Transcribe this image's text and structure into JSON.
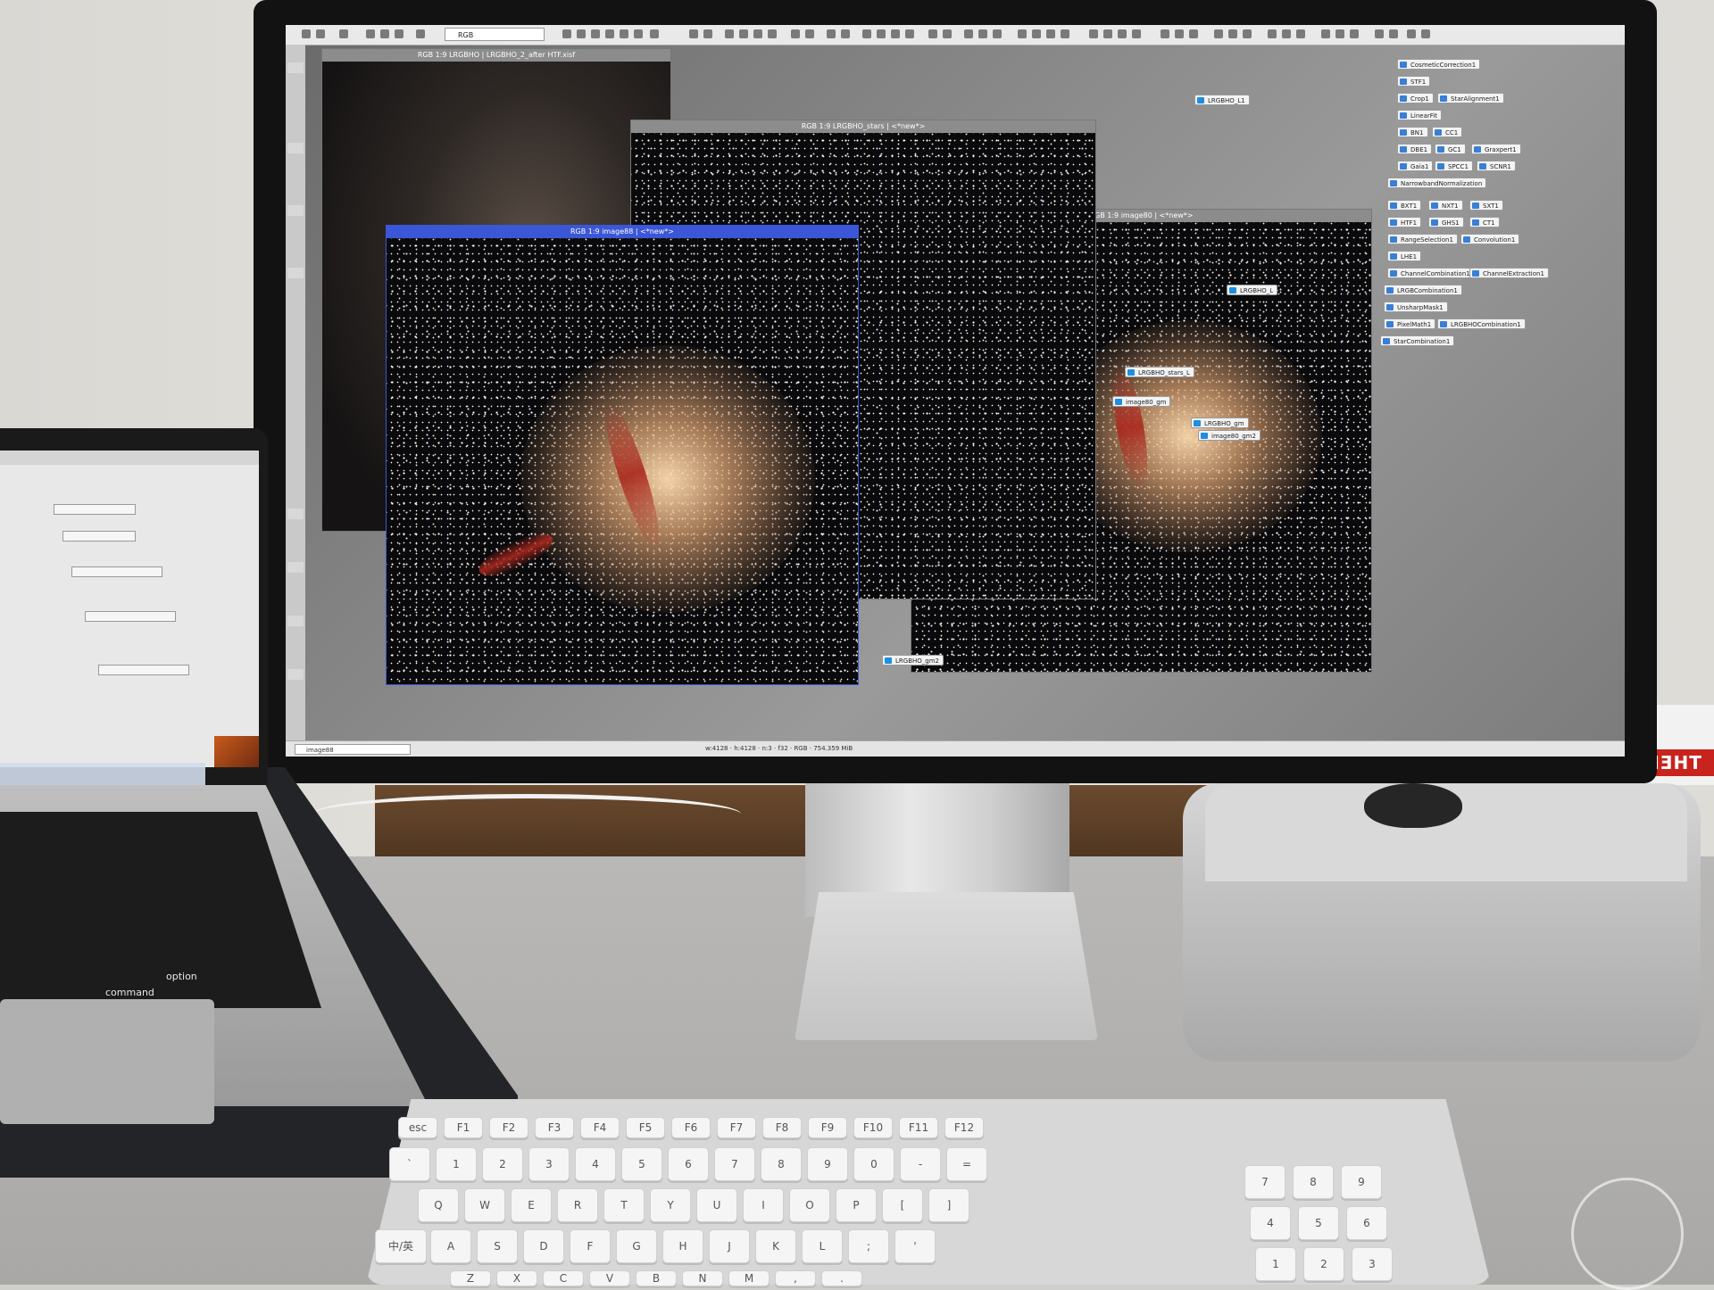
{
  "pixinsight": {
    "toolbar": {
      "color_space_select": "RGB"
    },
    "side_tabs": [
      "Process Console",
      "View Explorer",
      "Process Explorer",
      "Format Explorer",
      "File Explorer",
      "History Explorer",
      "Object Explorer",
      "Script Editor"
    ],
    "windows": [
      {
        "title": "RGB 1:9 LRGBHO | LRGBHO_2_after HTF.xisf"
      },
      {
        "title": "RGB 1:9 LRGBHO_stars | <*new*>"
      },
      {
        "title": "RGB 1:9 image80 | <*new*>"
      },
      {
        "title": "RGB 1:9 image88 | <*new*>"
      }
    ],
    "window_side_labels": [
      "image88",
      "LRGBHO_stars",
      "LRGBHO"
    ],
    "process_icons": [
      "CosmeticCorrection1",
      "STF1",
      "Crop1",
      "StarAlignment1",
      "LinearFit",
      "BN1",
      "CC1",
      "DBE1",
      "GC1",
      "Graxpert1",
      "Gaia1",
      "SPCC1",
      "SCNR1",
      "NarrowbandNormalization",
      "BXT1",
      "NXT1",
      "SXT1",
      "HTF1",
      "GHS1",
      "CT1",
      "RangeSelection1",
      "Convolution1",
      "LHE1",
      "ChannelCombination1",
      "ChannelExtraction1",
      "LRGBCombination1",
      "UnsharpMask1",
      "PixelMath1",
      "LRGBHOCombination1",
      "StarCombination1"
    ],
    "view_icons": [
      "LRGBHO_L1",
      "LRGBHO_L",
      "LRGBHO_stars_L",
      "image80_gm",
      "LRGBHO_gm",
      "image80_gm2",
      "LRGBHO_gm2"
    ],
    "statusbar": {
      "view_select": "image88",
      "status_text": "w:4128 · h:4128 · n:3 · f32 · RGB · 754.359 MiB"
    }
  },
  "desk": {
    "box_label": "THERMOS"
  },
  "laptop": {
    "keys": [
      "command",
      "option"
    ]
  },
  "keyboard": {
    "keys_row_fn": [
      "esc",
      "F1",
      "F2",
      "F3",
      "F4",
      "F5",
      "F6",
      "F7",
      "F8",
      "F9",
      "F10",
      "F11",
      "F12"
    ],
    "keys_row_num": [
      "`",
      "1",
      "2",
      "3",
      "4",
      "5",
      "6",
      "7",
      "8",
      "9",
      "0",
      "-",
      "="
    ],
    "keys_row_q": [
      "Q",
      "W",
      "E",
      "R",
      "T",
      "Y",
      "U",
      "I",
      "O",
      "P",
      "[",
      "]"
    ],
    "keys_row_a": [
      "A",
      "S",
      "D",
      "F",
      "G",
      "H",
      "J",
      "K",
      "L",
      ";",
      "'"
    ],
    "keys_row_z": [
      "Z",
      "X",
      "C",
      "V",
      "B",
      "N",
      "M",
      ",",
      "."
    ],
    "ime_key": "中/英",
    "numpad": [
      "7",
      "8",
      "9",
      "4",
      "5",
      "6",
      "1",
      "2",
      "3",
      "+",
      "-"
    ]
  }
}
